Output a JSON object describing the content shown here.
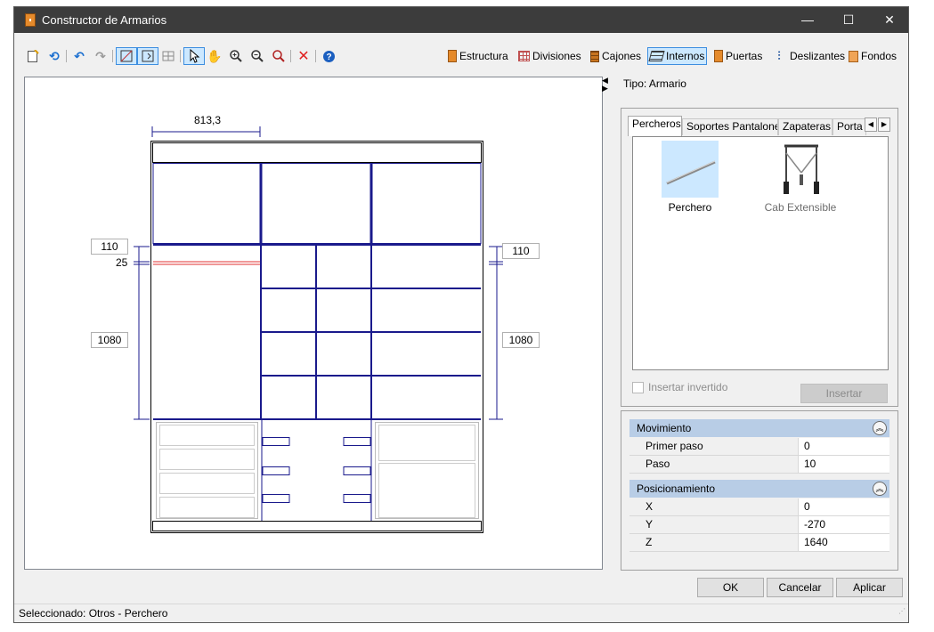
{
  "window": {
    "title": "Constructor de Armarios",
    "controls": {
      "minimize": "—",
      "maximize": "☐",
      "close": "✕"
    }
  },
  "toolbar": {
    "categories": [
      {
        "label": "Estructura",
        "icon": "door-icon"
      },
      {
        "label": "Divisiones",
        "icon": "grid-icon"
      },
      {
        "label": "Cajones",
        "icon": "drawers-icon"
      },
      {
        "label": "Internos",
        "icon": "internos-icon",
        "active": true
      },
      {
        "label": "Puertas",
        "icon": "doors-icon"
      },
      {
        "label": "Deslizantes",
        "icon": "sliding-icon"
      },
      {
        "label": "Fondos",
        "icon": "back-panel-icon"
      }
    ]
  },
  "drawing": {
    "width_dim": "813,3",
    "left_upper_dim": "110",
    "left_offset_dim": "25",
    "left_height_dim": "1080",
    "right_upper_dim": "110",
    "right_height_dim": "1080",
    "highlight_color": "#e03030",
    "line_color": "#1a1a8c"
  },
  "side": {
    "tipo": "Tipo: Armario",
    "tabs": [
      "Percheros",
      "Soportes Pantalones",
      "Zapateras",
      "Porta C"
    ],
    "items": [
      {
        "label": "Perchero",
        "selected": true
      },
      {
        "label": "Cab Extensible",
        "selected": false
      }
    ],
    "insert_inverted": "Insertar invertido",
    "insert_button": "Insertar"
  },
  "properties": {
    "movimiento": {
      "header": "Movimiento",
      "rows": [
        {
          "name": "Primer paso",
          "value": "0"
        },
        {
          "name": "Paso",
          "value": "10"
        }
      ]
    },
    "posicionamiento": {
      "header": "Posicionamiento",
      "rows": [
        {
          "name": "X",
          "value": "0"
        },
        {
          "name": "Y",
          "value": "-270"
        },
        {
          "name": "Z",
          "value": "1640"
        }
      ]
    }
  },
  "dialog": {
    "ok": "OK",
    "cancel": "Cancelar",
    "apply": "Aplicar"
  },
  "status": {
    "text": "Seleccionado: Otros - Perchero"
  }
}
